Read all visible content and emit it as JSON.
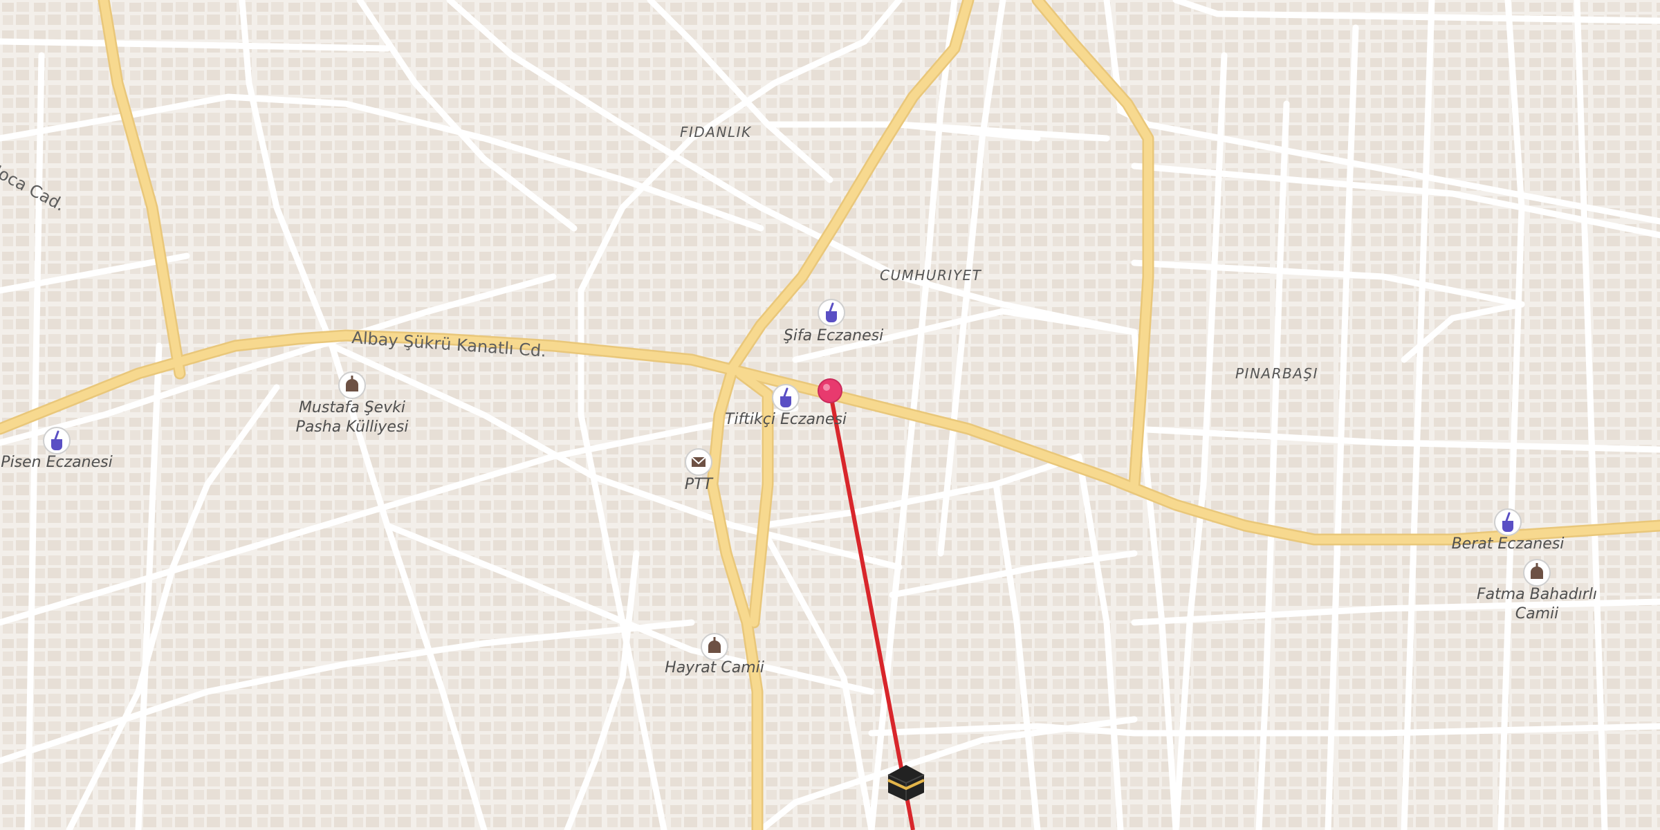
{
  "map": {
    "districts": [
      {
        "id": "fidanlik",
        "label": "FIDANLIK"
      },
      {
        "id": "cumhuriyet",
        "label": "CUMHURIYET"
      },
      {
        "id": "pinarbasi",
        "label": "PINARBAŞI"
      }
    ],
    "streets": [
      {
        "id": "albay",
        "label": "Albay Şükrü Kanatlı Cd."
      },
      {
        "id": "hoca",
        "label": "Hoca Cad."
      }
    ],
    "pois": [
      {
        "id": "sifa",
        "type": "pharmacy-icon",
        "label": "Şifa Eczanesi"
      },
      {
        "id": "tiftikci",
        "type": "pharmacy-icon",
        "label": "Tiftikçi Eczanesi"
      },
      {
        "id": "pisen",
        "type": "pharmacy-icon",
        "label": "Pisen Eczanesi"
      },
      {
        "id": "berat",
        "type": "pharmacy-icon",
        "label": "Berat Eczanesi"
      },
      {
        "id": "mustafa",
        "type": "mosque-icon",
        "label_line1": "Mustafa Şevki",
        "label_line2": "Pasha Külliyesi"
      },
      {
        "id": "fatma",
        "type": "mosque-icon",
        "label_line1": "Fatma Bahadırlı",
        "label_line2": "Camii"
      },
      {
        "id": "hayrat",
        "type": "mosque-icon",
        "label": "Hayrat Camii"
      },
      {
        "id": "ptt",
        "type": "mail-icon",
        "label": "PTT"
      }
    ],
    "markers": {
      "location_pin": "location-pin-icon",
      "qibla_target": "kaaba-icon",
      "qibla_line_color": "#d8262b",
      "pin_color": "#e83a6e"
    },
    "colors": {
      "background": "#f3efea",
      "building": "#e8e0d8",
      "minor_road": "#ffffff",
      "major_road": "#f7d98f",
      "poi_icon": "#5a4fc4"
    }
  }
}
